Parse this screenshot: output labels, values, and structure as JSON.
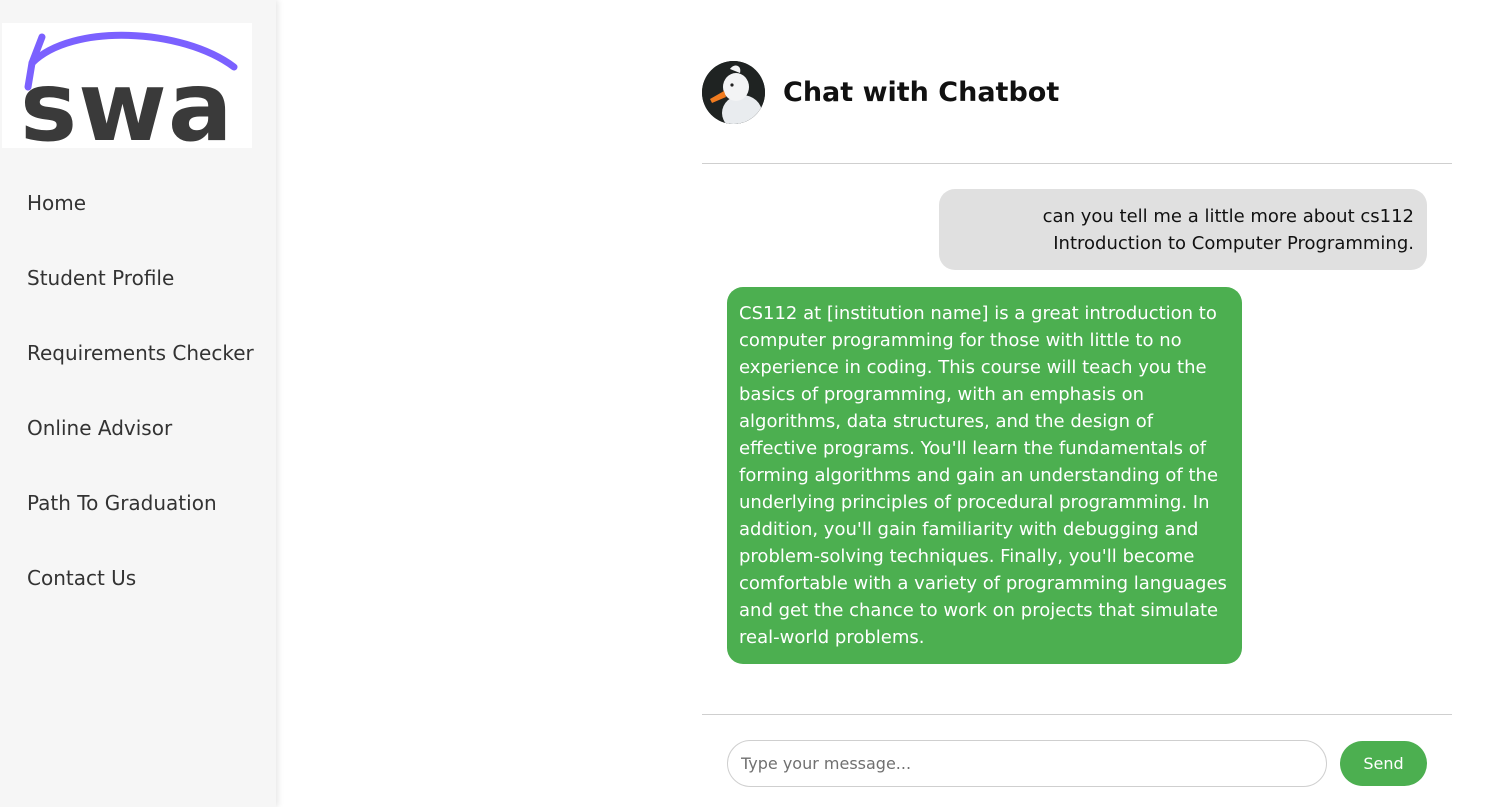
{
  "logo": {
    "text": "swa",
    "accent_color": "#7b61ff",
    "text_color": "#3a3a3a"
  },
  "sidebar": {
    "items": [
      {
        "label": "Home"
      },
      {
        "label": "Student Profile"
      },
      {
        "label": "Requirements Checker"
      },
      {
        "label": "Online Advisor"
      },
      {
        "label": "Path To Graduation"
      },
      {
        "label": "Contact Us"
      }
    ]
  },
  "chat": {
    "title": "Chat with Chatbot",
    "avatar_icon": "duck-avatar-icon",
    "messages": [
      {
        "role": "user",
        "text": "can you tell me a little more about cs112 Introduction to Computer Programming."
      },
      {
        "role": "bot",
        "text": "CS112 at [institution name] is a great introduction to computer programming for those with little to no experience in coding. This course will teach you the basics of programming, with an emphasis on algorithms, data structures, and the design of effective programs. You'll learn the fundamentals of forming algorithms and gain an understanding of the underlying principles of procedural programming. In addition, you'll gain familiarity with debugging and problem-solving techniques. Finally, you'll become comfortable with a variety of programming languages and get the chance to work on projects that simulate real-world problems."
      }
    ],
    "input": {
      "placeholder": "Type your message...",
      "value": ""
    },
    "send_label": "Send"
  },
  "colors": {
    "accent_green": "#4caf50",
    "user_bubble": "#e0e0e0",
    "sidebar_bg": "#f6f6f6"
  }
}
